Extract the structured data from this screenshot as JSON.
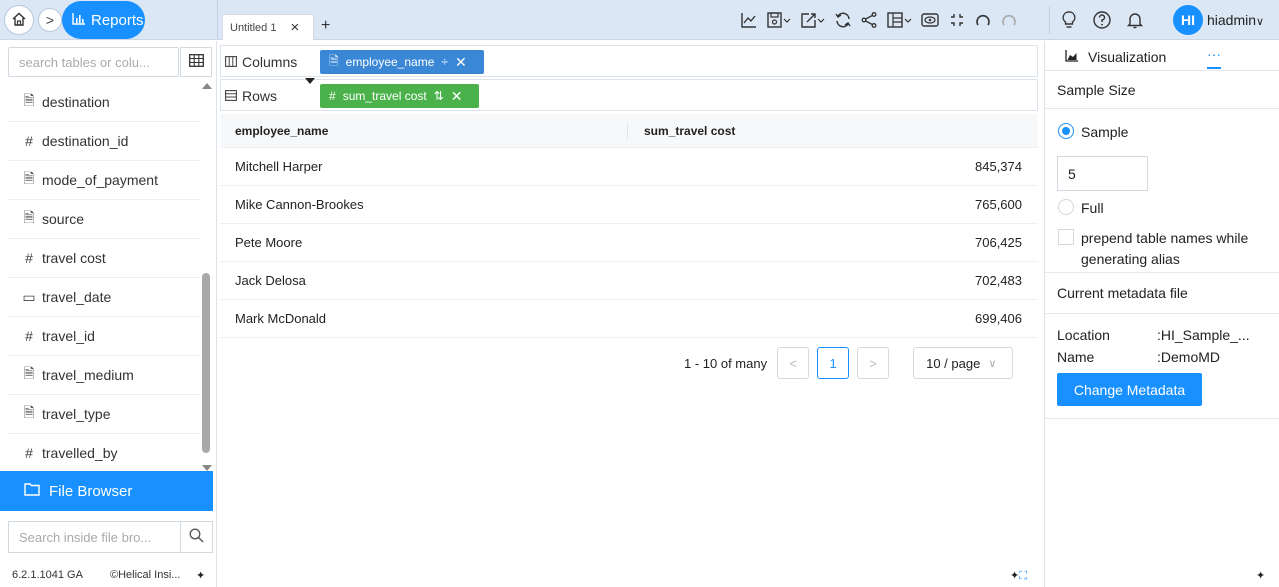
{
  "topbar": {
    "app_label": "Reports",
    "tab_title": "Untitled 1",
    "tab_add": "+",
    "tab_close": "×",
    "crumb_arrow": ">",
    "avatar_initials": "HI",
    "username": "hiadmin",
    "toolbar_icons": [
      "line-chart-icon",
      "save-icon",
      "export-icon",
      "refresh-icon",
      "share-icon",
      "layout-icon",
      "preview-icon",
      "fullscreen-icon",
      "undo-icon",
      "redo-icon"
    ],
    "right_icons": [
      "lightbulb-icon",
      "help-icon",
      "bell-icon"
    ]
  },
  "left": {
    "search_placeholder": "search tables or colu...",
    "fields": [
      {
        "name": "destination",
        "icon": "text-field-icon",
        "glyph": "🗎"
      },
      {
        "name": "destination_id",
        "icon": "number-field-icon",
        "glyph": "#"
      },
      {
        "name": "mode_of_payment",
        "icon": "text-field-icon",
        "glyph": "🗎"
      },
      {
        "name": "source",
        "icon": "text-field-icon",
        "glyph": "🗎"
      },
      {
        "name": "travel cost",
        "icon": "number-field-icon",
        "glyph": "#"
      },
      {
        "name": "travel_date",
        "icon": "date-field-icon",
        "glyph": "▭"
      },
      {
        "name": "travel_id",
        "icon": "number-field-icon",
        "glyph": "#"
      },
      {
        "name": "travel_medium",
        "icon": "text-field-icon",
        "glyph": "🗎"
      },
      {
        "name": "travel_type",
        "icon": "text-field-icon",
        "glyph": "🗎"
      },
      {
        "name": "travelled_by",
        "icon": "number-field-icon",
        "glyph": "#"
      }
    ],
    "file_browser_label": "File Browser",
    "file_search_placeholder": "Search inside file bro...",
    "version": "6.2.1.1041 GA",
    "copyright": "©Helical Insi..."
  },
  "center": {
    "columns_label": "Columns",
    "rows_label": "Rows",
    "column_chip": "employee_name",
    "row_chip": "sum_travel cost",
    "table": {
      "headers": [
        "employee_name",
        "sum_travel cost"
      ],
      "rows": [
        [
          "Mitchell Harper",
          "845,374"
        ],
        [
          "Mike Cannon-Brookes",
          "765,600"
        ],
        [
          "Pete Moore",
          "706,425"
        ],
        [
          "Jack Delosa",
          "702,483"
        ],
        [
          "Mark McDonald",
          "699,406"
        ]
      ]
    },
    "pager": {
      "summary": "1 - 10 of many",
      "prev": "<",
      "current": "1",
      "next": ">",
      "page_size": "10 / page"
    }
  },
  "right": {
    "tab_visualization": "Visualization",
    "tab_more": "···",
    "sample_size_title": "Sample Size",
    "sample_label": "Sample",
    "sample_value": "5",
    "full_label": "Full",
    "prepend_label": "prepend table names while generating alias",
    "metadata_title": "Current metadata file",
    "location_label": "Location",
    "location_value": ":HI_Sample_...",
    "name_label": "Name",
    "name_value": ":DemoMD",
    "change_button": "Change Metadata"
  },
  "colors": {
    "accent": "#1890ff",
    "column_chip": "#3a87d6",
    "row_chip": "#4bb24b",
    "topbar": "#dbe7f5"
  }
}
